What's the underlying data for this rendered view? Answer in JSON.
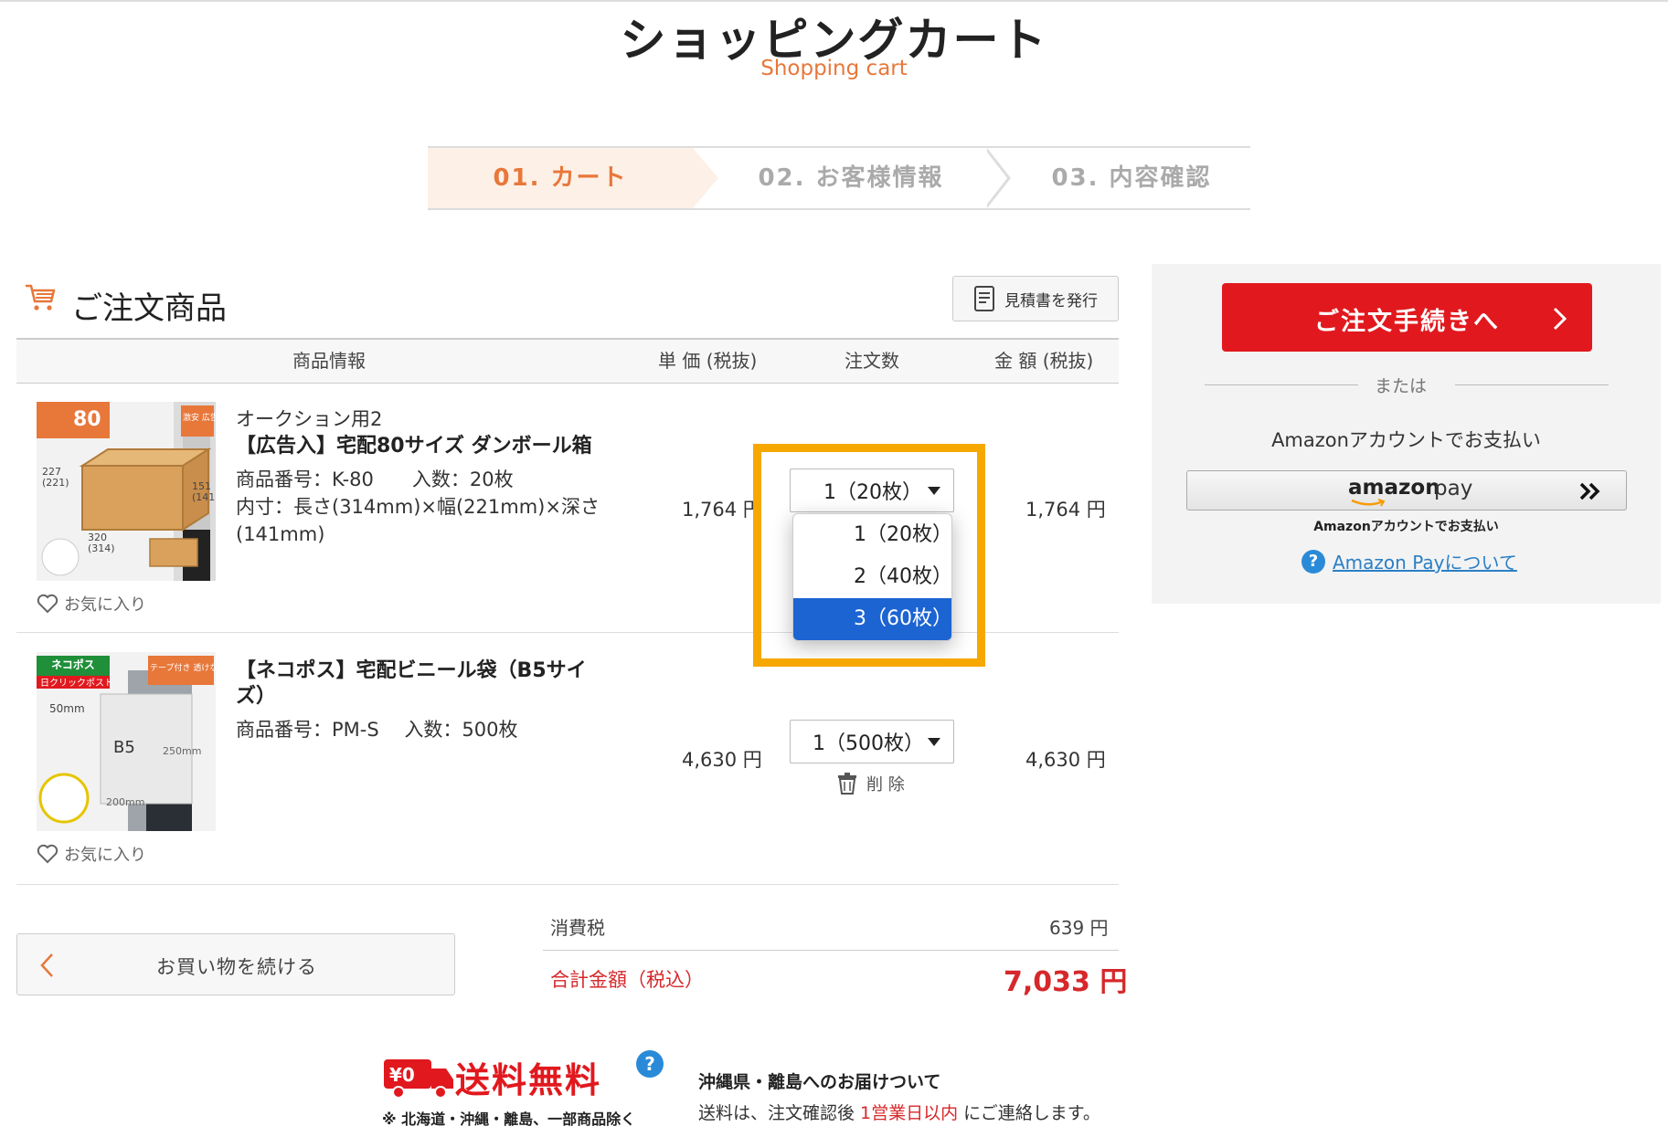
{
  "header": {
    "title": "ショッピングカート",
    "subtitle": "Shopping cart"
  },
  "steps": [
    {
      "label": "01. カート",
      "active": true
    },
    {
      "label": "02. お客様情報",
      "active": false
    },
    {
      "label": "03. 内容確認",
      "active": false
    }
  ],
  "section": {
    "title": "ご注文商品",
    "quote_button": "見積書を発行"
  },
  "table": {
    "headers": [
      "商品情報",
      "単 価 (税抜)",
      "注文数",
      "金 額 (税抜)"
    ]
  },
  "items": [
    {
      "thumb_badge": "80",
      "thumb_corner": "激安 広告入",
      "thumb_dims": [
        "227",
        "(221)",
        "151",
        "(141)",
        "320",
        "(314)"
      ],
      "line1": "オークション用2",
      "name": "【広告入】宅配80サイズ ダンボール箱",
      "code": "商品番号：K-80　　入数：20枚",
      "dims_line1": "内寸：長さ(314mm)×幅(221mm)×深さ",
      "dims_line2": "(141mm)",
      "unit_price": "1,764 円",
      "quantity": "1（20枚）",
      "amount": "1,764 円",
      "favorite": "お気に入り"
    },
    {
      "thumb_badge": "ネコポス",
      "thumb_sub": "日クリックポスト",
      "thumb_corner": "テープ付き 透けない",
      "thumb_dims": [
        "50mm",
        "B5",
        "250mm",
        "200mm"
      ],
      "name_line1": "【ネコポス】宅配ビニール袋（B5サイ",
      "name_line2": "ズ）",
      "code": "商品番号：PM-S　 入数：500枚",
      "unit_price": "4,630 円",
      "quantity": "1（500枚）",
      "amount": "4,630 円",
      "delete": "削 除",
      "favorite": "お気に入り"
    }
  ],
  "dropdown": {
    "options": [
      "1（20枚）",
      "2（40枚）",
      "3（60枚）"
    ],
    "highlighted_index": 2,
    "highlight_color": "#f6a800",
    "selected_color": "#1c64d2"
  },
  "summary": {
    "tax_label": "消費税",
    "tax_value": "639 円",
    "total_label": "合計金額（税込）",
    "total_value": "7,033 円"
  },
  "continue_button": "お買い物を続ける",
  "sidebar": {
    "order_button": "ご注文手続きへ",
    "or": "または",
    "amazon_desc": "Amazonアカウントでお支払い",
    "amazon_logo": "amazon",
    "amazon_pay": "pay",
    "amazon_small": "Amazonアカウントでお支払い",
    "amazon_link": "Amazon Payについて"
  },
  "shipping": {
    "badge": "¥0",
    "label": "送料無料",
    "note": "※ 北海道・沖縄・離島、一部商品除く",
    "info_title": "沖縄県・離島へのお届けついて",
    "info_text_a": "送料は、注文確認後 ",
    "info_text_red": "1営業日以内",
    "info_text_b": " にご連絡します。"
  },
  "colors": {
    "accent_orange": "#e8773a",
    "primary_red": "#e1191e",
    "total_red": "#d6282b",
    "link_blue": "#2a7fc7"
  }
}
